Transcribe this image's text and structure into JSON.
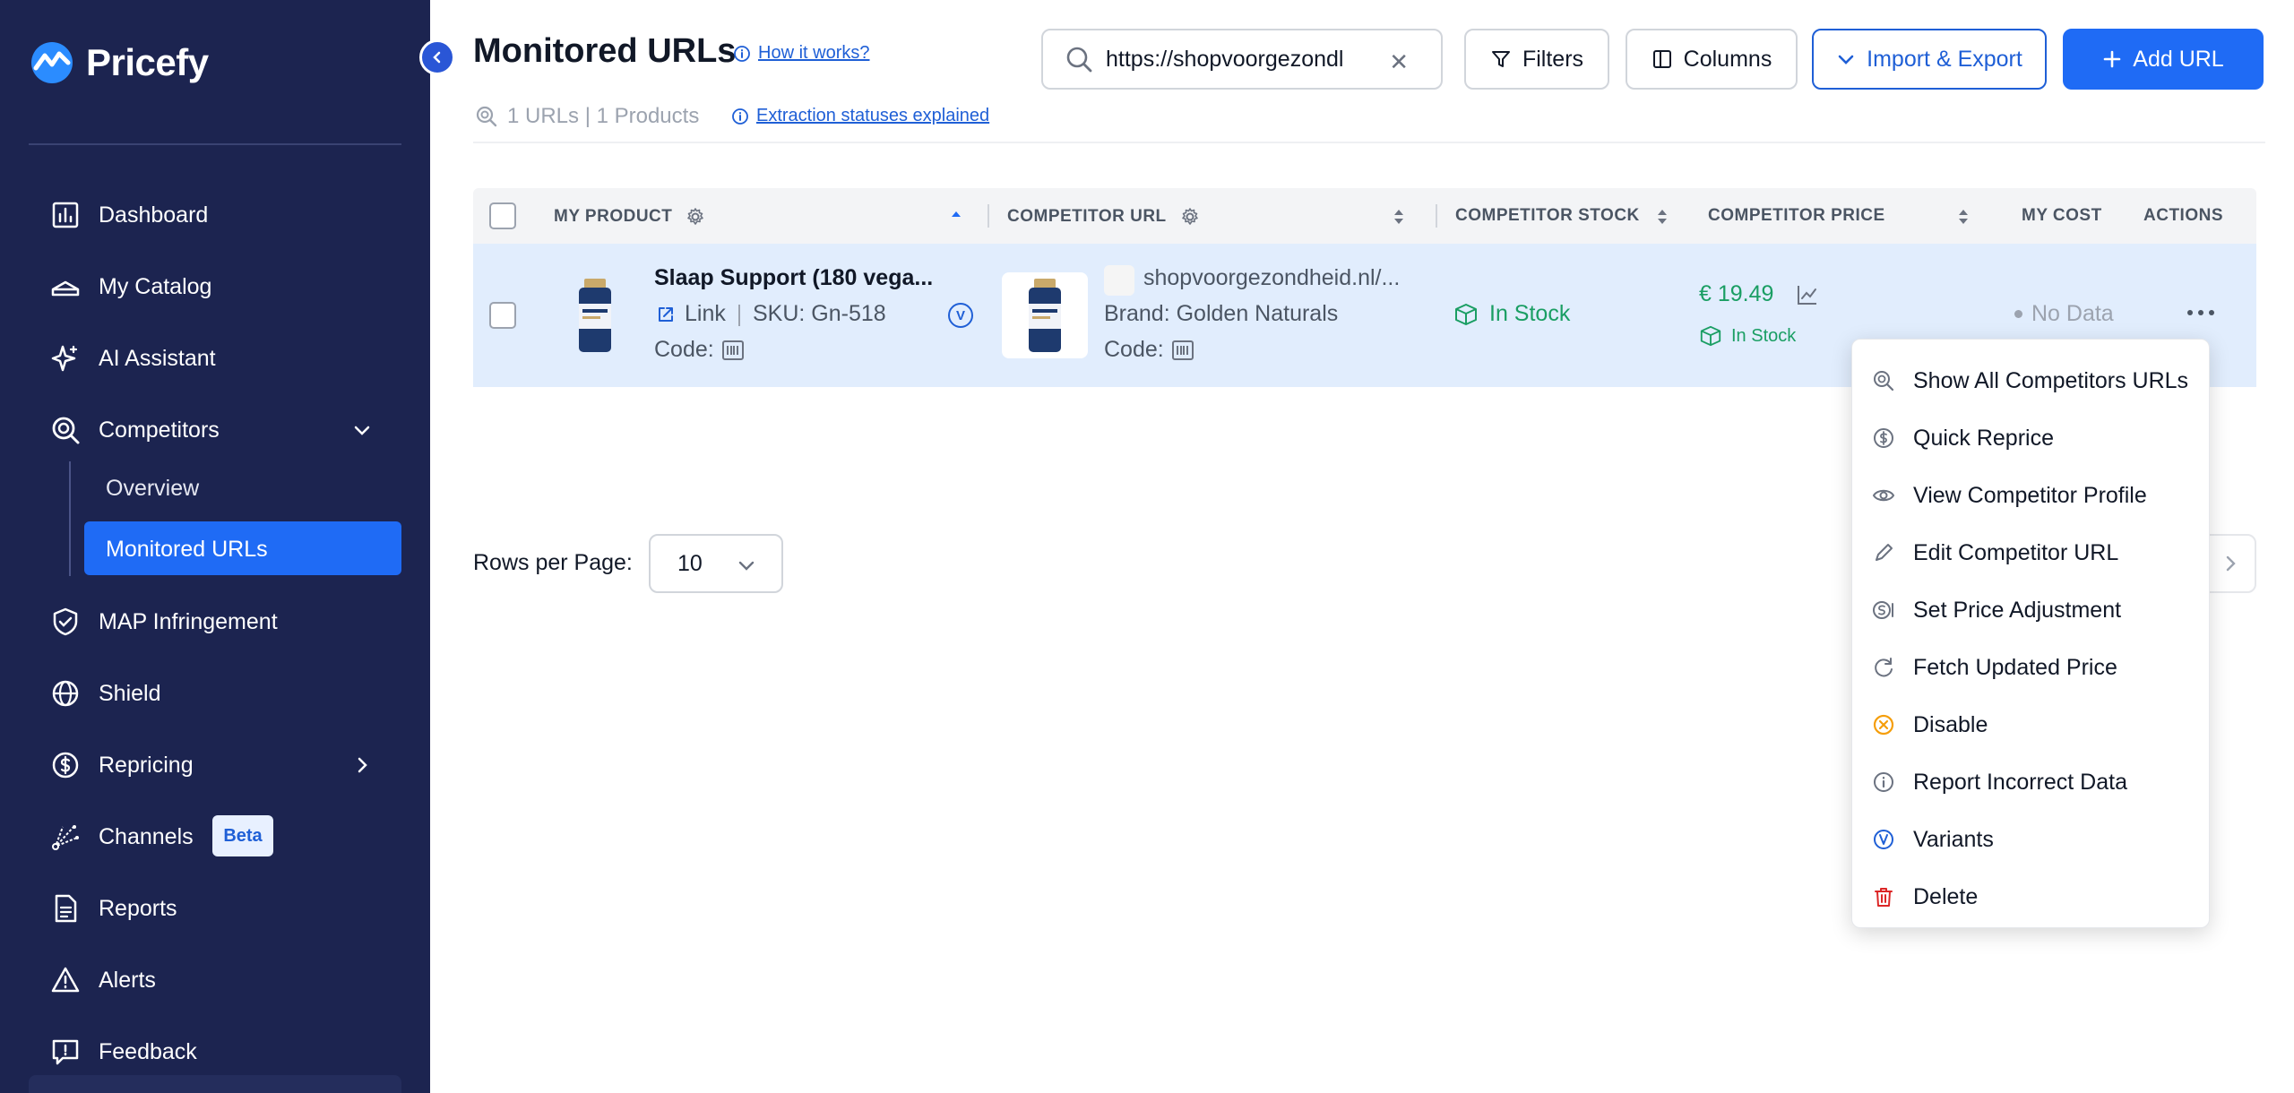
{
  "brand": {
    "name": "Pricefy"
  },
  "sidebar": {
    "items": [
      {
        "label": "Dashboard"
      },
      {
        "label": "My Catalog"
      },
      {
        "label": "AI Assistant"
      },
      {
        "label": "Competitors"
      },
      {
        "label": "MAP Infringement"
      },
      {
        "label": "Shield"
      },
      {
        "label": "Repricing"
      },
      {
        "label": "Channels",
        "badge": "Beta"
      },
      {
        "label": "Reports"
      },
      {
        "label": "Alerts"
      },
      {
        "label": "Feedback"
      }
    ],
    "sub_items": [
      {
        "label": "Overview"
      },
      {
        "label": "Monitored URLs"
      }
    ]
  },
  "header": {
    "title": "Monitored URLs",
    "how_it_works": "How it works?",
    "stats": "1 URLs | 1 Products",
    "extraction_link": "Extraction statuses explained",
    "search_value": "https://shopvoorgezondl",
    "filters_label": "Filters",
    "columns_label": "Columns",
    "import_export_label": "Import & Export",
    "add_url_label": "Add URL"
  },
  "table": {
    "columns": [
      "MY PRODUCT",
      "COMPETITOR URL",
      "COMPETITOR STOCK",
      "COMPETITOR PRICE",
      "MY COST",
      "ACTIONS"
    ],
    "row": {
      "product_name": "Slaap Support (180 vega...",
      "link_label": "Link",
      "sku": "SKU: Gn-518",
      "code_label": "Code:",
      "variant_badge": "V",
      "competitor_domain": "shopvoorgezondheid.nl/...",
      "brand": "Brand: Golden Naturals",
      "competitor_code_label": "Code:",
      "stock": "In Stock",
      "price": "€ 19.49",
      "price_stock": "In Stock",
      "my_cost": "No Data"
    }
  },
  "pagination": {
    "rows_per_page_label": "Rows per Page:",
    "rows_per_page_value": "10"
  },
  "actions_menu": [
    {
      "label": "Show All Competitors URLs"
    },
    {
      "label": "Quick Reprice"
    },
    {
      "label": "View Competitor Profile"
    },
    {
      "label": "Edit Competitor URL"
    },
    {
      "label": "Set Price Adjustment"
    },
    {
      "label": "Fetch Updated Price"
    },
    {
      "label": "Disable"
    },
    {
      "label": "Report Incorrect Data"
    },
    {
      "label": "Variants"
    },
    {
      "label": "Delete"
    }
  ],
  "colors": {
    "sidebar_bg": "#1c2450",
    "accent": "#1f6bf5",
    "success": "#1a9e63",
    "danger": "#dc2626",
    "disable": "#f59e0b"
  }
}
